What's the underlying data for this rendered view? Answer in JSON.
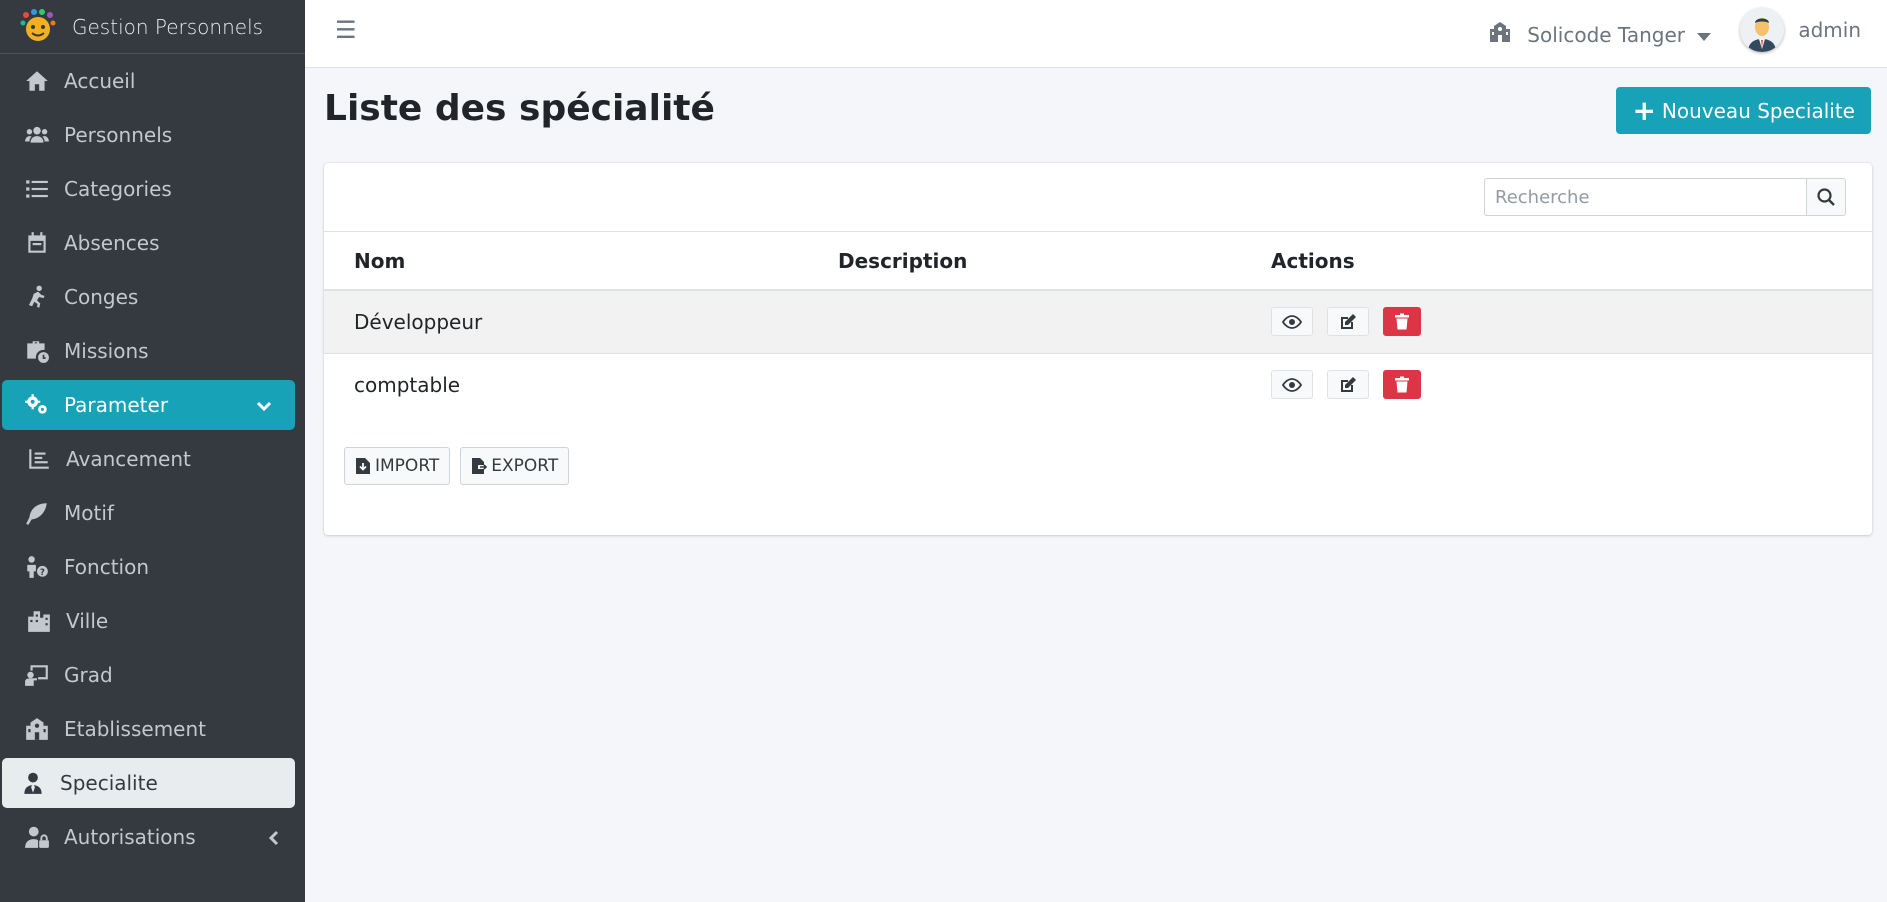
{
  "brand": {
    "name": "Gestion Personnels",
    "logo_icon": "app-logo-icon"
  },
  "sidebar": {
    "items": [
      {
        "label": "Accueil",
        "icon": "home-icon"
      },
      {
        "label": "Personnels",
        "icon": "users-icon"
      },
      {
        "label": "Categories",
        "icon": "list-icon"
      },
      {
        "label": "Absences",
        "icon": "calendar-icon"
      },
      {
        "label": "Conges",
        "icon": "running-icon"
      },
      {
        "label": "Missions",
        "icon": "briefcase-clock-icon"
      },
      {
        "label": "Parameter",
        "icon": "cogs-icon",
        "state": "expanded-active"
      },
      {
        "label": "Avancement",
        "icon": "chart-line-icon"
      },
      {
        "label": "Motif",
        "icon": "feather-icon"
      },
      {
        "label": "Fonction",
        "icon": "user-question-icon"
      },
      {
        "label": "Ville",
        "icon": "city-icon"
      },
      {
        "label": "Grad",
        "icon": "chalkboard-teacher-icon"
      },
      {
        "label": "Etablissement",
        "icon": "school-icon"
      },
      {
        "label": "Specialite",
        "icon": "user-tie-icon",
        "state": "current"
      },
      {
        "label": "Autorisations",
        "icon": "user-lock-icon"
      }
    ]
  },
  "topbar": {
    "menu_icon": "hamburger-icon",
    "company": "Solicode Tanger",
    "user": "admin"
  },
  "page": {
    "title": "Liste des spécialité",
    "new_button": "Nouveau Specialite"
  },
  "search": {
    "placeholder": "Recherche"
  },
  "table": {
    "headers": [
      "Nom",
      "Description",
      "Actions"
    ],
    "rows": [
      {
        "nom": "Développeur",
        "description": ""
      },
      {
        "nom": "comptable",
        "description": ""
      }
    ]
  },
  "io": {
    "import": "IMPORT",
    "export": "EXPORT"
  },
  "colors": {
    "sidebar": "#343a40",
    "accent": "#17a2b8",
    "danger": "#dc3545",
    "background": "#f4f6f9"
  }
}
